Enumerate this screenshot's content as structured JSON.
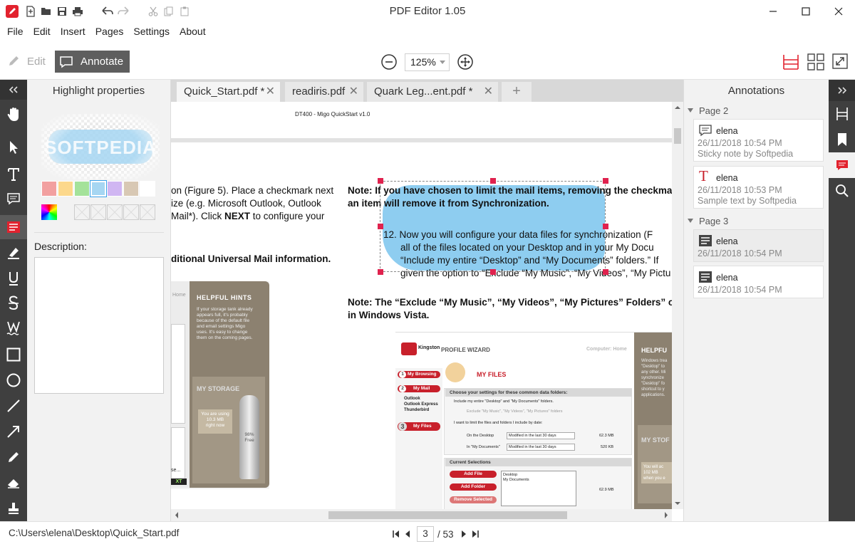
{
  "window": {
    "title": "PDF Editor 1.05"
  },
  "menu": [
    "File",
    "Edit",
    "Insert",
    "Pages",
    "Settings",
    "About"
  ],
  "toolbar": {
    "edit_label": "Edit",
    "annotate_label": "Annotate",
    "zoom_value": "125%"
  },
  "props": {
    "title": "Highlight properties",
    "preview_text": "SOFTPEDIA",
    "description_label": "Description:",
    "description_value": "",
    "colors": [
      "#f2a0a0",
      "#fcd88c",
      "#a4e29a",
      "#a6d6f2",
      "#d0b6f2",
      "#d8c8b4",
      "#ffffff"
    ],
    "selected_color": "#a6d6f2"
  },
  "tabs": [
    {
      "label": "Quick_Start.pdf *",
      "active": true
    },
    {
      "label": "readiris.pdf",
      "active": false
    },
    {
      "label": "Quark Leg...ent.pdf *",
      "active": false
    }
  ],
  "doc": {
    "header": "DT400 - Migo QuickStart v1.0",
    "left_col": [
      "on (Figure 5). Place a checkmark next",
      "ize (e.g. Microsoft Outlook, Outlook",
      "Mail*). Click NEXT to configure your",
      "ditional Universal Mail information."
    ],
    "left_col_bold_word": "NEXT",
    "note1_line1": "Note: If you have chosen to limit the mail items, removing the checkmark",
    "note1_line2": "an item will remove it from Synchronization.",
    "item12": [
      "12. Now you will configure your data files for synchronization (F",
      "all of the files located on your Desktop and in your My Docu",
      "“Include my entire “Desktop” and “My Documents” folders.” If",
      "given the option to “Exclude “My Music”, “My Videos”, “My Pictu"
    ],
    "note2_line1": "Note: The “Exclude “My Music”, “My Videos”, “My Pictures” Folders” optio",
    "note2_line2": "in Windows Vista.",
    "shot_left": {
      "link": "Home",
      "hints_title": "HELPFUL HINTS",
      "hints_text": [
        "If your storage tank already",
        "appears full, it's probably",
        "because of the default file",
        "and email settings Migo",
        "uses. It's easy to change",
        "them on the coming pages."
      ],
      "storage_title": "MY STORAGE",
      "using_lines": [
        "You are using",
        "10.3 MB",
        "right now"
      ],
      "tank_lines": [
        "98%",
        "Free"
      ],
      "next_label": "XT",
      "frag_label": "se..."
    },
    "shot_right": {
      "brand": "Kingston",
      "wizard": "PROFILE WIZARD",
      "computer": "Computer: Home",
      "hints": "HELPFU",
      "hints_text": [
        "Windows trea",
        "\"Desktop\" to",
        "any other. Mi",
        "synchronize",
        "\"Desktop\" fo",
        "shortcut to y",
        "applications."
      ],
      "storage": "MY STOF",
      "storage_text": [
        "You will ac",
        "102 MB",
        "when you e"
      ],
      "my_files": "MY FILES",
      "nav": [
        "My Browsing",
        "My Mail",
        "My Files"
      ],
      "nav_nums": [
        "1",
        "2",
        "3"
      ],
      "mail_items": [
        "Outlook",
        "Outlook Express",
        "Thunderbird"
      ],
      "choose": "Choose your settings for these common data folders:",
      "opt1": "Include my entire \"Desktop\" and \"My Documents\" folders.",
      "opt1_sub": "Exclude \"My Music\", \"My Videos\", \"My Pictures\" folders",
      "opt2": "I want to limit the files and folders I include by date:",
      "row1_label": "On the Desktop",
      "row1_value": "Modified in the last 30 days",
      "row1_size": "62.3 MB",
      "row2_label": "In \"My Documents\"",
      "row2_value": "Modified in the last 30 days",
      "row2_size": "520 KB",
      "current": "Current Selections",
      "buttons": [
        "Add File",
        "Add Folder",
        "Remove Selected"
      ],
      "list": [
        "Desktop",
        "My Documents"
      ],
      "list_size": "62.9 MB"
    }
  },
  "annotations": {
    "title": "Annotations",
    "groups": [
      {
        "label": "Page 2",
        "items": [
          {
            "icon": "sticky-note",
            "user": "elena",
            "time": "26/11/2018 10:54 PM",
            "sub": "Sticky note by Softpedia",
            "selected": false
          },
          {
            "icon": "text",
            "user": "elena",
            "time": "26/11/2018 10:53 PM",
            "sub": "Sample text by Softpedia",
            "selected": false
          }
        ]
      },
      {
        "label": "Page 3",
        "items": [
          {
            "icon": "highlight",
            "user": "elena",
            "time": "26/11/2018 10:54 PM",
            "sub": "",
            "selected": true
          },
          {
            "icon": "highlight",
            "user": "elena",
            "time": "26/11/2018 10:54 PM",
            "sub": "",
            "selected": false
          }
        ]
      }
    ]
  },
  "status": {
    "path": "C:\\Users\\elena\\Desktop\\Quick_Start.pdf",
    "page": "3",
    "total": "/ 53"
  },
  "colors": {
    "accent": "#e2222e",
    "highlight": "#8ecdf0",
    "handle": "#e0224e",
    "dark_strip": "#3f3f3f"
  }
}
